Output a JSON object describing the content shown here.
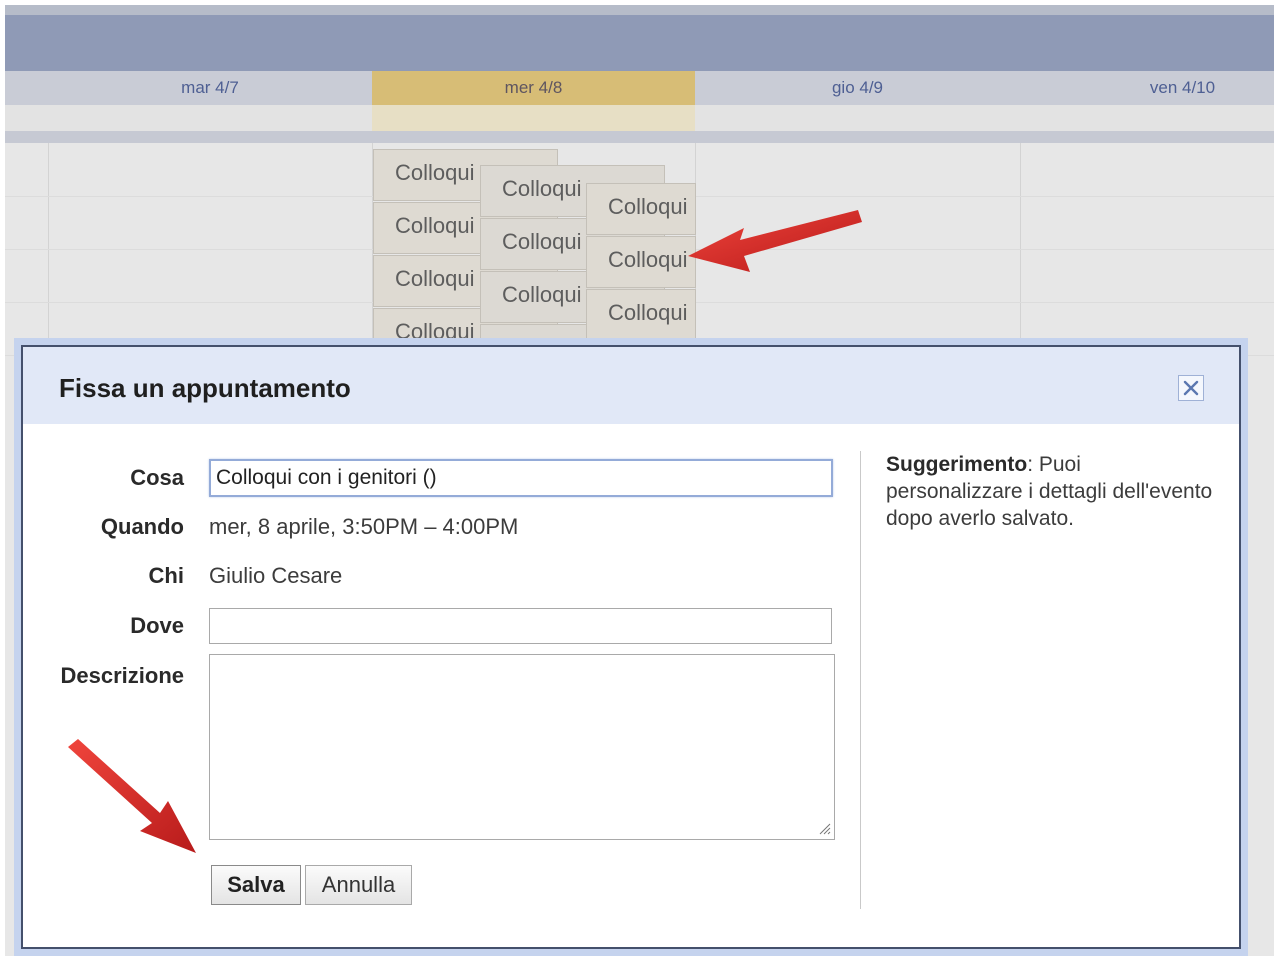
{
  "calendar": {
    "days": [
      "mar 4/7",
      "mer 4/8",
      "gio 4/9",
      "ven 4/10"
    ],
    "today_index": 1,
    "event_label": "Colloqui",
    "partial_event_label": "Colloqui"
  },
  "dialog": {
    "title": "Fissa un appuntamento",
    "close_icon": "close-icon",
    "what_label": "Cosa",
    "what_value": "Colloqui con i genitori ()",
    "when_label": "Quando",
    "when_value": "mer, 8 aprile, 3:50PM – 4:00PM",
    "who_label": "Chi",
    "who_value": "Giulio Cesare",
    "where_label": "Dove",
    "where_value": "",
    "description_label": "Descrizione",
    "description_value": "",
    "save_label": "Salva",
    "cancel_label": "Annulla",
    "tip_bold": "Suggerimento",
    "tip_text": ": Puoi personalizzare i dettagli dell'evento dopo averlo salvato."
  },
  "colors": {
    "accent_red": "#d01818",
    "today_header": "#d7bd76",
    "dialog_header": "#e1e8f7"
  }
}
